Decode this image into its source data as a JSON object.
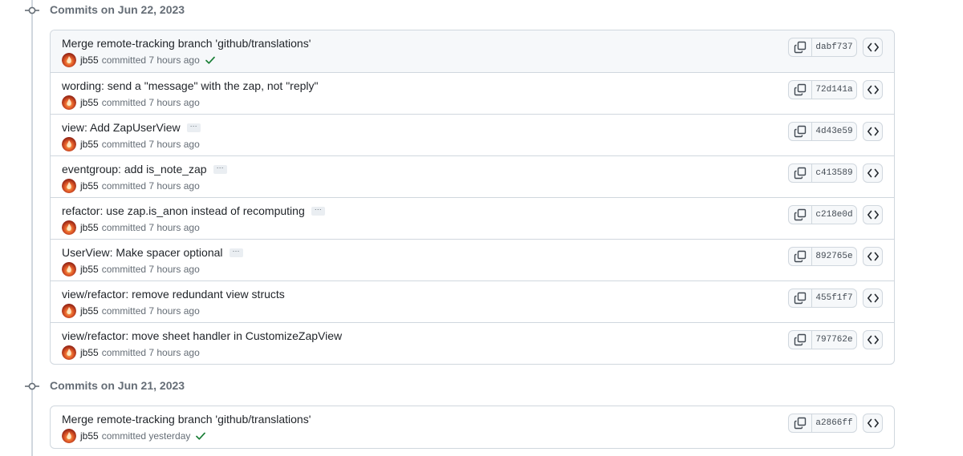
{
  "groups": [
    {
      "title": "Commits on Jun 22, 2023",
      "commits": [
        {
          "message": "Merge remote-tracking branch 'github/translations'",
          "has_ellipsis": false,
          "author": "jb55",
          "committed_text": "committed 7 hours ago",
          "verified": true,
          "sha": "dabf737"
        },
        {
          "message": "wording: send a \"message\" with the zap, not \"reply\"",
          "has_ellipsis": false,
          "author": "jb55",
          "committed_text": "committed 7 hours ago",
          "verified": false,
          "sha": "72d141a"
        },
        {
          "message": "view: Add ZapUserView",
          "has_ellipsis": true,
          "author": "jb55",
          "committed_text": "committed 7 hours ago",
          "verified": false,
          "sha": "4d43e59"
        },
        {
          "message": "eventgroup: add is_note_zap",
          "has_ellipsis": true,
          "author": "jb55",
          "committed_text": "committed 7 hours ago",
          "verified": false,
          "sha": "c413589"
        },
        {
          "message": "refactor: use zap.is_anon instead of recomputing",
          "has_ellipsis": true,
          "author": "jb55",
          "committed_text": "committed 7 hours ago",
          "verified": false,
          "sha": "c218e0d"
        },
        {
          "message": "UserView: Make spacer optional",
          "has_ellipsis": true,
          "author": "jb55",
          "committed_text": "committed 7 hours ago",
          "verified": false,
          "sha": "892765e"
        },
        {
          "message": "view/refactor: remove redundant view structs",
          "has_ellipsis": false,
          "author": "jb55",
          "committed_text": "committed 7 hours ago",
          "verified": false,
          "sha": "455f1f7"
        },
        {
          "message": "view/refactor: move sheet handler in CustomizeZapView",
          "has_ellipsis": false,
          "author": "jb55",
          "committed_text": "committed 7 hours ago",
          "verified": false,
          "sha": "797762e"
        }
      ]
    },
    {
      "title": "Commits on Jun 21, 2023",
      "commits": [
        {
          "message": "Merge remote-tracking branch 'github/translations'",
          "has_ellipsis": false,
          "author": "jb55",
          "committed_text": "committed yesterday",
          "verified": true,
          "sha": "a2866ff"
        }
      ]
    }
  ],
  "ellipsis_label": "···",
  "icons": {
    "commit": "git-commit-icon",
    "copy": "copy-icon",
    "browse": "code-browse-icon",
    "verified": "check-icon"
  },
  "colors": {
    "accent_check": "#1a7f37",
    "border": "#d0d7de",
    "muted": "#656d76"
  }
}
